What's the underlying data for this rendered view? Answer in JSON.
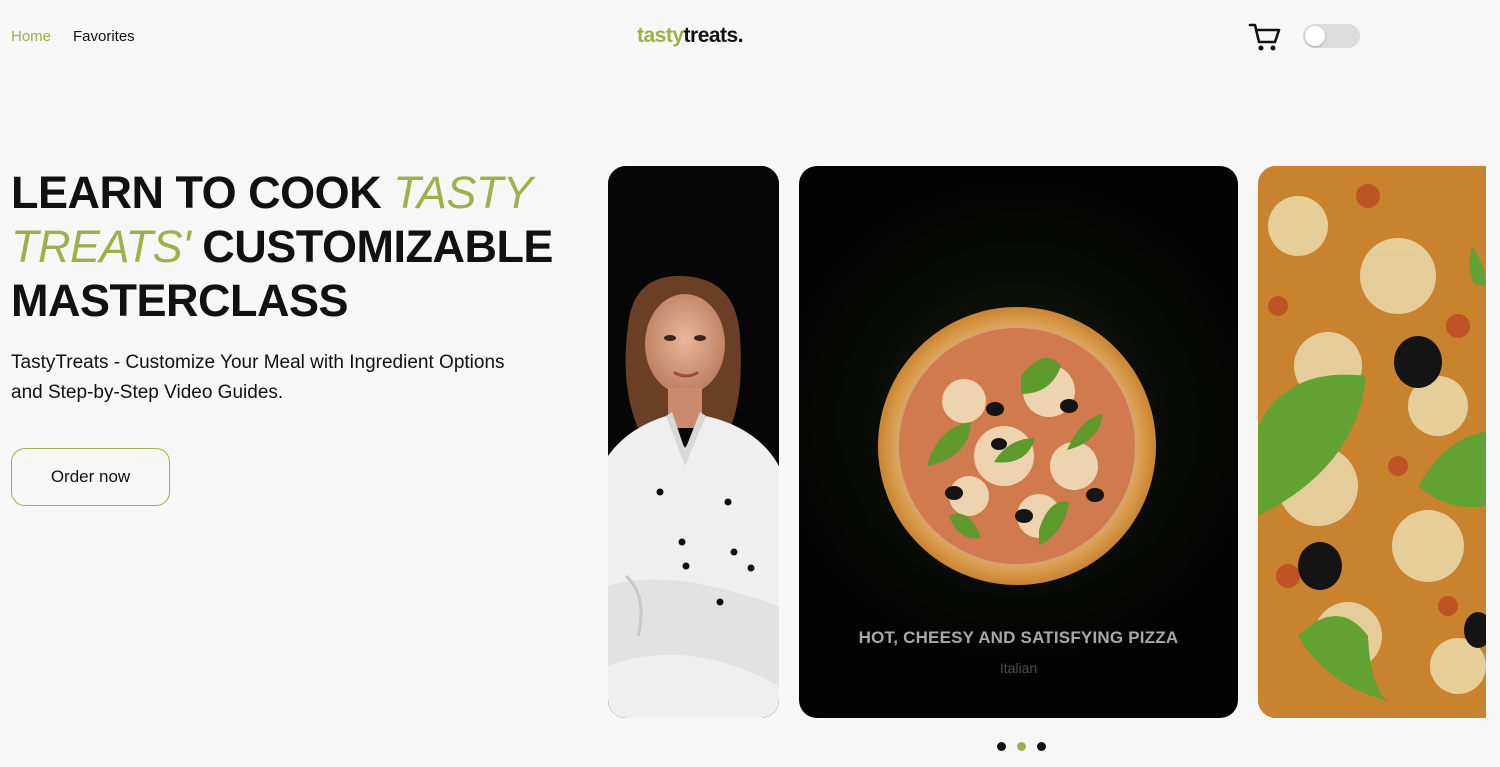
{
  "nav": {
    "home": "Home",
    "favorites": "Favorites"
  },
  "logo": {
    "part1": "tasty",
    "part2": "treats."
  },
  "header": {
    "cart_icon": "cart-icon",
    "theme_toggle": "off"
  },
  "hero": {
    "title_part1": "LEARN TO COOK ",
    "title_accent": "TASTY TREATS'",
    "title_part2": " CUSTOMIZABLE MASTERCLASS",
    "description": "TastyTreats - Customize Your Meal with Ingredient Options and Step-by-Step Video Guides.",
    "order_button": "Order now"
  },
  "slider": {
    "slides": [
      {
        "name": "chef-image"
      },
      {
        "title": "HOT, CHEESY AND SATISFYING PIZZA",
        "subtitle": "Italian"
      },
      {
        "name": "pizza-closeup-image"
      }
    ],
    "dots": 3,
    "active_dot": 1
  },
  "colors": {
    "accent": "#9bb14a",
    "background": "#f7f7f7",
    "text": "#111111"
  }
}
